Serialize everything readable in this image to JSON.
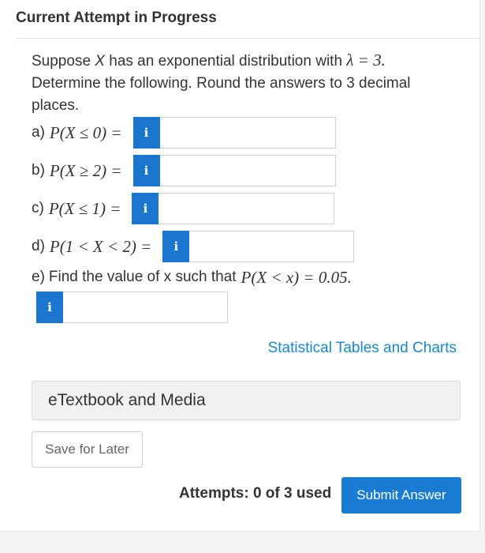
{
  "header": {
    "title": "Current Attempt in Progress"
  },
  "question": {
    "intro_line1_prefix": "Suppose ",
    "variable": "X",
    "intro_line1_mid": " has an exponential distribution with ",
    "lambda_expr": "λ = 3.",
    "intro_line2": "Determine the following. Round the answers to 3 decimal places."
  },
  "parts": [
    {
      "label": "a)",
      "expr": "P(X ≤ 0) =",
      "info": "i",
      "value": ""
    },
    {
      "label": "b)",
      "expr": "P(X ≥ 2) =",
      "info": "i",
      "value": ""
    },
    {
      "label": "c)",
      "expr": "P(X ≤ 1) =",
      "info": "i",
      "value": ""
    },
    {
      "label": "d)",
      "expr": "P(1 < X < 2) =",
      "info": "i",
      "value": ""
    }
  ],
  "part_e": {
    "label": "e)",
    "text": "Find the value of x such that",
    "expr": "P(X < x) = 0.05.",
    "info": "i",
    "value": ""
  },
  "links": {
    "tables": "Statistical Tables and Charts"
  },
  "media": {
    "label": "eTextbook and Media"
  },
  "actions": {
    "save_label": "Save for Later",
    "attempts_text": "Attempts: 0 of 3 used",
    "submit_label": "Submit Answer"
  },
  "colors": {
    "accent": "#1a76cf",
    "link": "#1a88c8"
  }
}
